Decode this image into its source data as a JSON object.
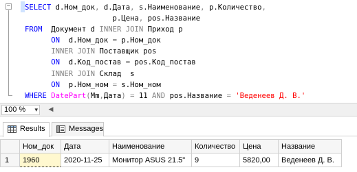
{
  "editor": {
    "collapse_symbol": "−",
    "lines": [
      [
        {
          "t": "SELECT",
          "c": "kw"
        },
        {
          "t": " d.Ном_док",
          "c": "pl"
        },
        {
          "t": ",",
          "c": "gr"
        },
        {
          "t": " d.Дата",
          "c": "pl"
        },
        {
          "t": ",",
          "c": "gr"
        },
        {
          "t": " s.Наименование",
          "c": "pl"
        },
        {
          "t": ",",
          "c": "gr"
        },
        {
          "t": " p.Количество",
          "c": "pl"
        },
        {
          "t": ",",
          "c": "gr"
        }
      ],
      [
        {
          "t": "                    p.Цена",
          "c": "pl"
        },
        {
          "t": ",",
          "c": "gr"
        },
        {
          "t": " pos.Название",
          "c": "pl"
        }
      ],
      [
        {
          "t": "FROM",
          "c": "kw"
        },
        {
          "t": "  Документ d ",
          "c": "pl"
        },
        {
          "t": "INNER JOIN",
          "c": "gr"
        },
        {
          "t": " Приход p",
          "c": "pl"
        }
      ],
      [
        {
          "t": "      ",
          "c": "pl"
        },
        {
          "t": "ON",
          "c": "kw"
        },
        {
          "t": "  d.Ном_док ",
          "c": "pl"
        },
        {
          "t": "=",
          "c": "gr"
        },
        {
          "t": " p.Ном_док",
          "c": "pl"
        }
      ],
      [
        {
          "t": "      ",
          "c": "pl"
        },
        {
          "t": "INNER JOIN",
          "c": "gr"
        },
        {
          "t": " Поставщик pos",
          "c": "pl"
        }
      ],
      [
        {
          "t": "      ",
          "c": "pl"
        },
        {
          "t": "ON",
          "c": "kw"
        },
        {
          "t": "  d.Код_постав ",
          "c": "pl"
        },
        {
          "t": "=",
          "c": "gr"
        },
        {
          "t": " pos.Код_постав",
          "c": "pl"
        }
      ],
      [
        {
          "t": "      ",
          "c": "pl"
        },
        {
          "t": "INNER JOIN",
          "c": "gr"
        },
        {
          "t": " Склад  s",
          "c": "pl"
        }
      ],
      [
        {
          "t": "      ",
          "c": "pl"
        },
        {
          "t": "ON",
          "c": "kw"
        },
        {
          "t": "  p.Ном_ном ",
          "c": "pl"
        },
        {
          "t": "=",
          "c": "gr"
        },
        {
          "t": " s.Ном_ном",
          "c": "pl"
        }
      ],
      [
        {
          "t": "WHERE",
          "c": "kw"
        },
        {
          "t": " DatePart",
          "c": "fn"
        },
        {
          "t": "(",
          "c": "gr"
        },
        {
          "t": "Mm",
          "c": "pl"
        },
        {
          "t": ",",
          "c": "gr"
        },
        {
          "t": "Дата",
          "c": "pl"
        },
        {
          "t": ")",
          "c": "gr"
        },
        {
          "t": " ",
          "c": "pl"
        },
        {
          "t": "=",
          "c": "gr"
        },
        {
          "t": " 11 ",
          "c": "pl"
        },
        {
          "t": "AND",
          "c": "gr"
        },
        {
          "t": " pos.Название ",
          "c": "pl"
        },
        {
          "t": "=",
          "c": "gr"
        },
        {
          "t": " 'Веденеев Д. В.'",
          "c": "str"
        }
      ]
    ]
  },
  "zoom": {
    "value": "100 %",
    "caret": "▾",
    "scroll_arrow": "◀"
  },
  "tabs": {
    "results": "Results",
    "messages": "Messages"
  },
  "results": {
    "columns": [
      "Ном_док",
      "Дата",
      "Наименование",
      "Количество",
      "Цена",
      "Название"
    ],
    "rows": [
      {
        "rownum": "1",
        "cells": [
          "1960",
          "2020-11-25",
          "Монитор ASUS 21.5\"",
          "9",
          "5820,00",
          "Веденеев Д. В."
        ]
      }
    ]
  },
  "colors": {
    "keyword": "#0000ff",
    "operator": "#808080",
    "function": "#ff00ff",
    "string": "#ff0000",
    "selected_cell": "#fff8cf"
  }
}
